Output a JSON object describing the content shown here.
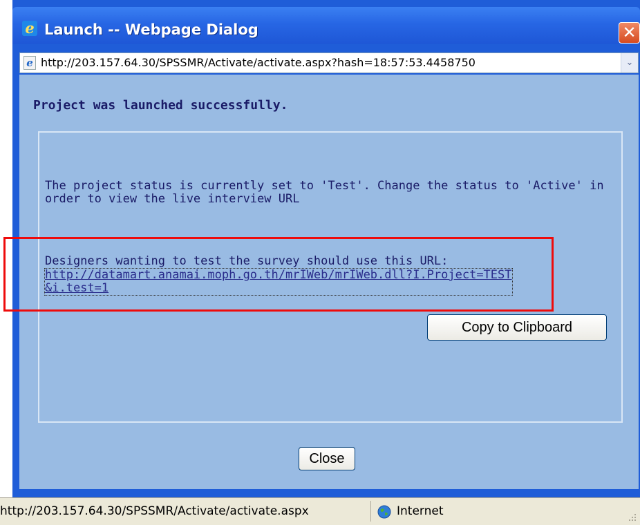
{
  "window": {
    "title": "Launch -- Webpage Dialog",
    "close_symbol": "✕",
    "title_icon": "ie-icon"
  },
  "addressbar": {
    "url": "http://203.157.64.30/SPSSMR/Activate/activate.aspx?hash=18:57:53.4458750",
    "page_icon": "ie-page-icon",
    "dropdown_symbol": "⌄"
  },
  "content": {
    "heading": "Project was launched successfully.",
    "status_message": "The project status is currently set to 'Test'. Change the status to 'Active' in order to view the live interview URL",
    "designers_label": "Designers wanting to test the survey should use this URL:",
    "test_url": "http://datamart.anamai.moph.go.th/mrIWeb/mrIWeb.dll?I.Project=TEST&i.test=1",
    "copy_button": "Copy to Clipboard",
    "close_button": "Close"
  },
  "statusbar": {
    "url": "http://203.157.64.30/SPSSMR/Activate/activate.aspx",
    "zone": "Internet",
    "zone_icon": "globe-icon"
  },
  "colors": {
    "window_frame": "#1f5dd8",
    "content_bg": "#99bbe3",
    "heading_text": "#1a1b67",
    "annotation_red": "#ee0b0b"
  }
}
